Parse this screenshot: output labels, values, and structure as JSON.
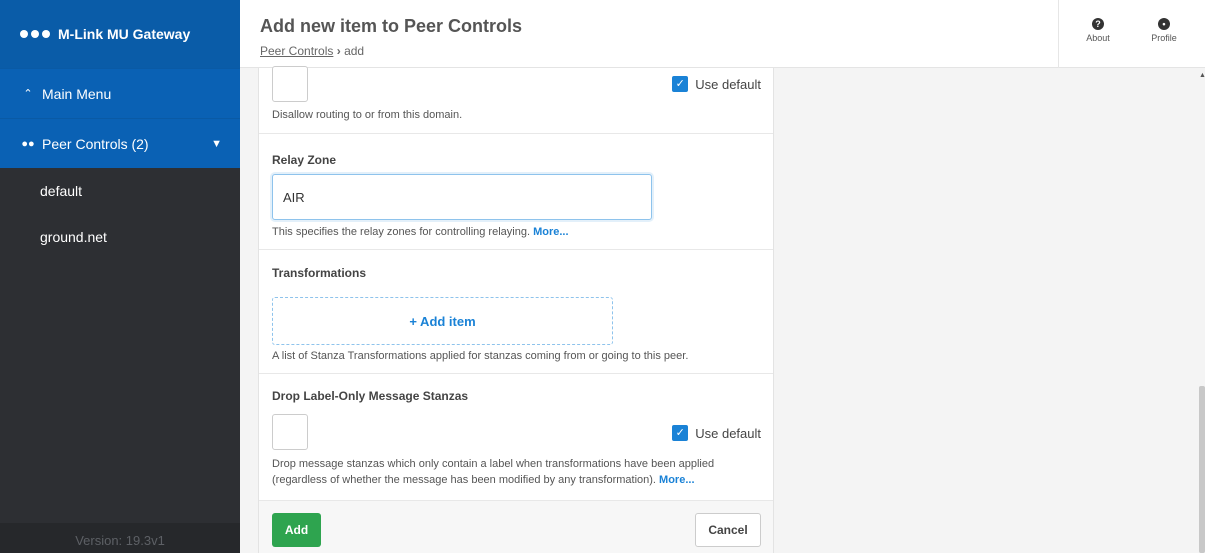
{
  "app": {
    "title": "M-Link MU Gateway",
    "version": "Version: 19.3v1"
  },
  "sidebar": {
    "main_menu": {
      "label": "Main Menu",
      "icon": "chevrons-up-icon"
    },
    "peer_controls": {
      "label": "Peer Controls (2)",
      "icon": "users-icon",
      "expanded": true
    },
    "items": [
      {
        "label": "default"
      },
      {
        "label": "ground.net"
      }
    ]
  },
  "header": {
    "title": "Add new item to Peer Controls",
    "breadcrumb": {
      "parent": "Peer Controls",
      "separator": "›",
      "current": "add"
    },
    "about": "About",
    "profile": "Profile"
  },
  "form": {
    "disallow": {
      "checked": false,
      "use_default_label": "Use default",
      "use_default_checked": true,
      "help": "Disallow routing to or from this domain."
    },
    "relay_zone": {
      "label": "Relay Zone",
      "value": "AIR",
      "help": "This specifies the relay zones for controlling relaying.",
      "more": "More..."
    },
    "transformations": {
      "label": "Transformations",
      "add_item": "+ Add item",
      "help": "A list of Stanza Transformations applied for stanzas coming from or going to this peer."
    },
    "drop_label_only": {
      "label": "Drop Label-Only Message Stanzas",
      "checked": false,
      "use_default_label": "Use default",
      "use_default_checked": true,
      "help": "Drop message stanzas which only contain a label when transformations have been applied (regardless of whether the message has been modified by any transformation).",
      "more": "More..."
    },
    "add_button": "Add",
    "cancel_button": "Cancel"
  },
  "colors": {
    "brand": "#0a5ca8",
    "sidebar_bg": "#2d2f33",
    "accent": "#1a82d6",
    "add_button": "#2ea44f"
  }
}
